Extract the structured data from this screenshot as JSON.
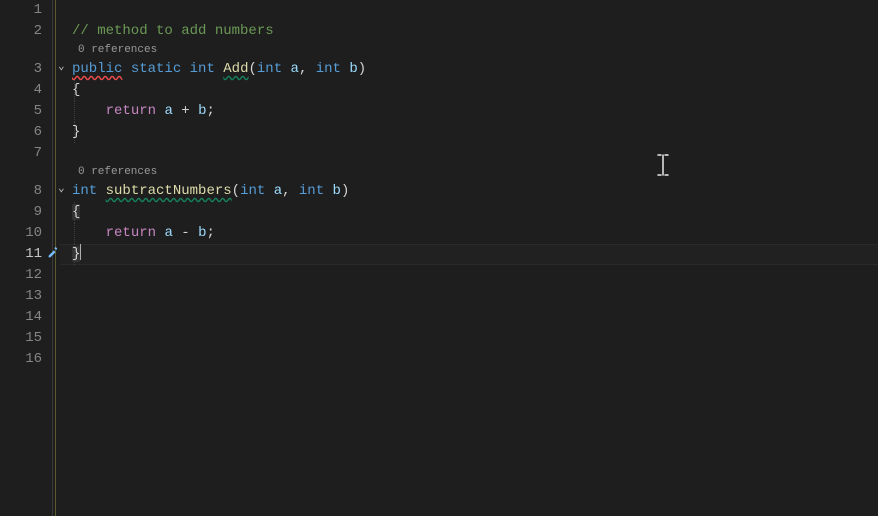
{
  "lineNumbers": [
    "1",
    "2",
    "3",
    "4",
    "5",
    "6",
    "7",
    "8",
    "9",
    "10",
    "11",
    "12",
    "13",
    "14",
    "15",
    "16"
  ],
  "codelens": {
    "add": "0 references",
    "subtract": "0 references"
  },
  "code": {
    "l2_comment": "// method to add numbers",
    "l3_kw_public": "public",
    "l3_kw_static": "static",
    "l3_type_int": "int",
    "l3_method_add": "Add",
    "l3_open": "(",
    "l3_p1_type": "int",
    "l3_p1_name": "a",
    "l3_comma": ",",
    "l3_p2_type": "int",
    "l3_p2_name": "b",
    "l3_close": ")",
    "l4_brace": "{",
    "l5_return": "return",
    "l5_a": "a",
    "l5_plus": "+",
    "l5_b": "b",
    "l5_semi": ";",
    "l6_brace": "}",
    "l8_type_int": "int",
    "l8_method_sub": "subtractNumbers",
    "l8_open": "(",
    "l8_p1_type": "int",
    "l8_p1_name": "a",
    "l8_comma": ",",
    "l8_p2_type": "int",
    "l8_p2_name": "b",
    "l8_close": ")",
    "l9_brace": "{",
    "l10_return": "return",
    "l10_a": "a",
    "l10_minus": "-",
    "l10_b": "b",
    "l10_semi": ";",
    "l11_brace": "}"
  },
  "icons": {
    "screwdriver_title": "quick-actions"
  }
}
